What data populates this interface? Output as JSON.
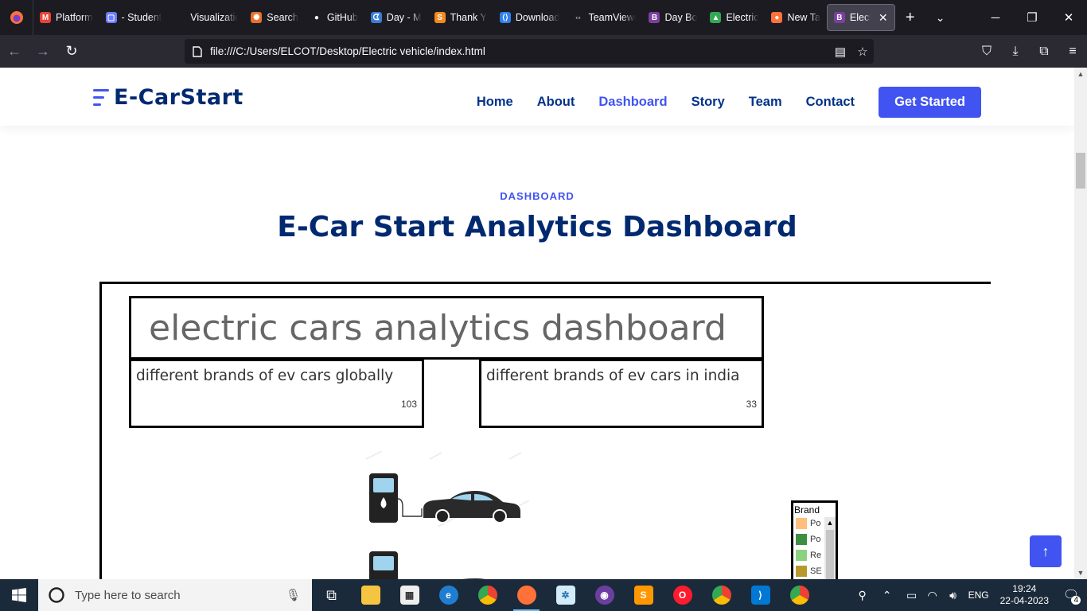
{
  "browser": {
    "tabs": [
      {
        "label": "Platform",
        "color": "#e94235",
        "glyph": "M"
      },
      {
        "label": "- Student",
        "color": "#6e7bff",
        "glyph": "▢"
      },
      {
        "label": "Visualization",
        "color": "#1c1b22",
        "glyph": ""
      },
      {
        "label": "Search",
        "color": "#e8702a",
        "glyph": "✺"
      },
      {
        "label": "GitHub",
        "color": "#ffffff",
        "glyph": "●"
      },
      {
        "label": "Day - M",
        "color": "#3a7bd5",
        "glyph": "ᗧ"
      },
      {
        "label": "Thank Y",
        "color": "#f4891f",
        "glyph": "S"
      },
      {
        "label": "Download",
        "color": "#2f80ed",
        "glyph": "⟨⟩"
      },
      {
        "label": "TeamViewer",
        "color": "#ffffff",
        "glyph": "⇔"
      },
      {
        "label": "Day Bo",
        "color": "#7b3fa0",
        "glyph": "B"
      },
      {
        "label": "Electric",
        "color": "#34a853",
        "glyph": "▲"
      },
      {
        "label": "New Ta",
        "color": "#ff7139",
        "glyph": "●"
      }
    ],
    "active_tab": {
      "label": "Elect",
      "glyph": "B"
    },
    "url": "file:///C:/Users/ELCOT/Desktop/Electric vehicle/index.html"
  },
  "site": {
    "brand": "E-CarStart",
    "nav": [
      "Home",
      "About",
      "Dashboard",
      "Story",
      "Team",
      "Contact"
    ],
    "active_nav": "Dashboard",
    "cta": "Get Started"
  },
  "section": {
    "label": "DASHBOARD",
    "title": "E-Car Start Analytics Dashboard"
  },
  "dashboard": {
    "title": "electric cars analytics dashboard",
    "kpi_global": {
      "label": "different brands of ev cars globally",
      "value": "103"
    },
    "kpi_india": {
      "label": "different brands of ev cars in india",
      "value": "33"
    },
    "legend": {
      "title": "Brand",
      "items": [
        {
          "label": "Po",
          "color": "#ffbe7d"
        },
        {
          "label": "Po",
          "color": "#3e8e41"
        },
        {
          "label": "Re",
          "color": "#8cd17d"
        },
        {
          "label": "SE",
          "color": "#b6992d"
        }
      ]
    }
  },
  "taskbar": {
    "search_placeholder": "Type here to search",
    "lang": "ENG",
    "time": "19:24",
    "date": "22-04-2023",
    "notifications": "4"
  }
}
